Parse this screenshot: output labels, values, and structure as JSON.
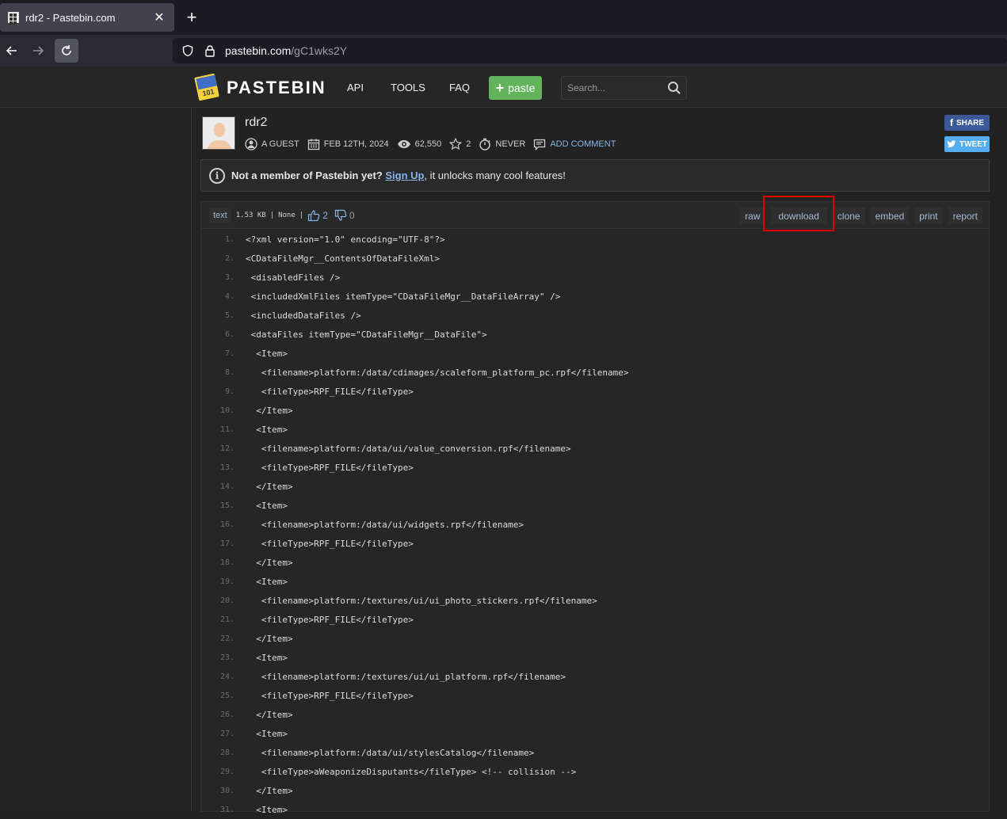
{
  "browser": {
    "tab_title": "rdr2 - Pastebin.com",
    "tab_close": "✕",
    "new_tab": "+",
    "url_host": "pastebin.com",
    "url_path": "/gC1wks2Y"
  },
  "site": {
    "logo_text": "PASTEBIN",
    "nav": {
      "api": "API",
      "tools": "TOOLS",
      "faq": "FAQ"
    },
    "paste_button": "paste",
    "search_placeholder": "Search..."
  },
  "paste": {
    "title": "rdr2",
    "author": "A GUEST",
    "date": "FEB 12TH, 2024",
    "views": "62,550",
    "stars": "2",
    "expires": "NEVER",
    "add_comment": "ADD COMMENT",
    "share": "SHARE",
    "tweet": "TWEET"
  },
  "notice": {
    "bold": "Not a member of Pastebin yet?",
    "signup": "Sign Up",
    "rest": ", it unlocks many cool features!"
  },
  "toolbar": {
    "syntax": "text",
    "size": "1.53 KB",
    "sep1": "|",
    "category": "None",
    "sep2": "|",
    "likes": "2",
    "dislikes": "0",
    "raw": "raw",
    "download": "download",
    "clone": "clone",
    "embed": "embed",
    "print": "print",
    "report": "report"
  },
  "code_lines": [
    "<?xml version=\"1.0\" encoding=\"UTF-8\"?>",
    "<CDataFileMgr__ContentsOfDataFileXml>",
    " <disabledFiles />",
    " <includedXmlFiles itemType=\"CDataFileMgr__DataFileArray\" />",
    " <includedDataFiles />",
    " <dataFiles itemType=\"CDataFileMgr__DataFile\">",
    "  <Item>",
    "   <filename>platform:/data/cdimages/scaleform_platform_pc.rpf</filename>",
    "   <fileType>RPF_FILE</fileType>",
    "  </Item>",
    "  <Item>",
    "   <filename>platform:/data/ui/value_conversion.rpf</filename>",
    "   <fileType>RPF_FILE</fileType>",
    "  </Item>",
    "  <Item>",
    "   <filename>platform:/data/ui/widgets.rpf</filename>",
    "   <fileType>RPF_FILE</fileType>",
    "  </Item>",
    "  <Item>",
    "   <filename>platform:/textures/ui/ui_photo_stickers.rpf</filename>",
    "   <fileType>RPF_FILE</fileType>",
    "  </Item>",
    "  <Item>",
    "   <filename>platform:/textures/ui/ui_platform.rpf</filename>",
    "   <fileType>RPF_FILE</fileType>",
    "  </Item>",
    "  <Item>",
    "   <filename>platform:/data/ui/stylesCatalog</filename>",
    "   <fileType>aWeaponizeDisputants</fileType> <!-- collision -->",
    "  </Item>",
    "  <Item>"
  ],
  "line_numbers": [
    "1.",
    "2.",
    "3.",
    "4.",
    "5.",
    "6.",
    "7.",
    "8.",
    "9.",
    "10.",
    "11.",
    "12.",
    "13.",
    "14.",
    "15.",
    "16.",
    "17.",
    "18.",
    "19.",
    "20.",
    "21.",
    "22.",
    "23.",
    "24.",
    "25.",
    "26.",
    "27.",
    "28.",
    "29.",
    "30.",
    "31."
  ]
}
